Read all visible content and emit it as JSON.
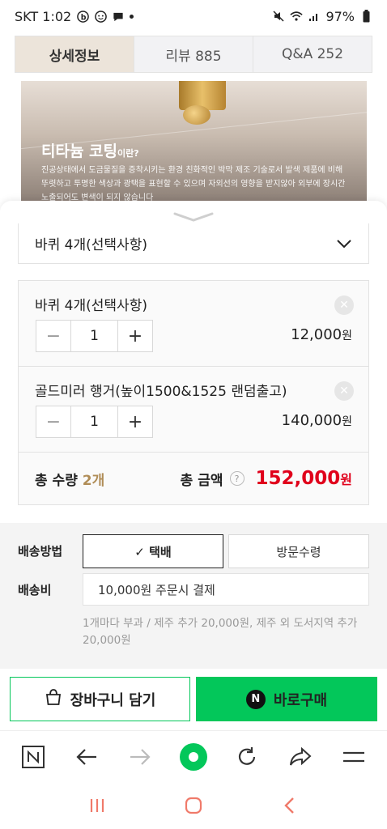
{
  "status_bar": {
    "carrier_time": "SKT 1:02",
    "battery": "97%"
  },
  "tabs": [
    {
      "label": "상세정보"
    },
    {
      "label": "리뷰  885"
    },
    {
      "label": "Q&A  252"
    }
  ],
  "hero": {
    "title": "티타늄 코팅",
    "title_suffix": "이란?",
    "desc": "진공상태에서 도금물질을 증착시키는 환경 친화적인 박막 제조 기술로서 발색 제품에 비해 뚜렷하고 투명한 색상과 광택을 표현할 수 있으며 자외선의 영향을 받지않아 외부에 장시간 노출되어도 변색이 되지 않습니다"
  },
  "option_select": {
    "label": "바퀴 4개(선택사항)"
  },
  "options": [
    {
      "name": "바퀴 4개(선택사항)",
      "qty": "1",
      "price": "12,000",
      "currency": "원"
    },
    {
      "name": "골드미러 행거(높이1500&1525 랜덤출고)",
      "qty": "1",
      "price": "140,000",
      "currency": "원"
    }
  ],
  "stepper": {
    "minus": "−",
    "plus": "+"
  },
  "totals": {
    "qty_label": "총 수량",
    "qty_value": "2개",
    "amount_label": "총 금액",
    "help": "?",
    "amount": "152,000",
    "currency": "원"
  },
  "shipping": {
    "method_label": "배송방법",
    "methods": [
      "✓ 택배",
      "방문수령"
    ],
    "fee_label": "배송비",
    "fee_value": "10,000원 주문시 결제",
    "note": "1개마다 부과 / 제주 추가 20,000원, 제주 외 도서지역 추가 20,000원"
  },
  "actions": {
    "cart": "장바구니 담기",
    "buy": "바로구매",
    "buy_logo": "N"
  },
  "colors": {
    "accent_green": "#03c75a",
    "price_red": "#e0001b",
    "active_tab": "#ece4da"
  },
  "icons": [
    "chevron-down-icon",
    "close-icon",
    "cart-bag-icon",
    "naver-n-icon",
    "back-icon",
    "forward-icon",
    "reload-icon",
    "share-icon",
    "menu-icon",
    "recent-apps-icon",
    "home-icon",
    "nav-back-icon"
  ]
}
